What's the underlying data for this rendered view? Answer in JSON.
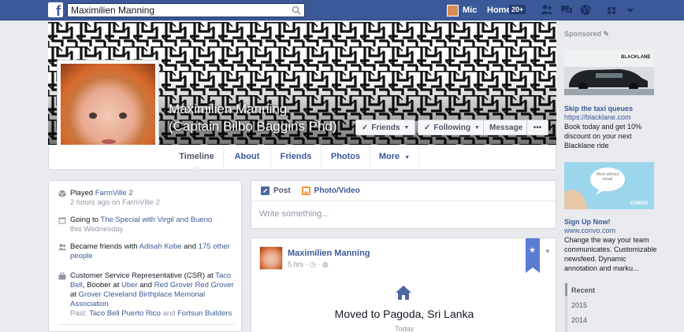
{
  "topbar": {
    "logo": "f",
    "search_value": "Maximilien Manning",
    "user_name": "Mic",
    "home_label": "Home",
    "home_count": "20+"
  },
  "profile": {
    "name": "Maximilien Manning",
    "nickname": "(Captain Bilbo Baggins Phd)"
  },
  "cover_buttons": {
    "friends": "Friends",
    "following": "Following",
    "message": "Message",
    "more": "•••"
  },
  "tabs": [
    {
      "label": "Timeline"
    },
    {
      "label": "About"
    },
    {
      "label": "Friends"
    },
    {
      "label": "Photos"
    },
    {
      "label": "More"
    }
  ],
  "activity": {
    "a1": {
      "pre": "Played ",
      "link": "FarmVille 2",
      "sub": "2 hours ago on FarmVille 2"
    },
    "a2": {
      "pre": "Going to ",
      "link": "The Special with Virgil and Bueno",
      "sub": "this Wednesday"
    },
    "a3": {
      "pre": "Became friends with ",
      "link1": "Adisah Kobe",
      "mid": " and ",
      "link2": "175 other people"
    },
    "a4": {
      "pre": "Customer Service Representative (CSR) at ",
      "l1": "Taco Bell",
      "t1": ", ",
      "l2": "Boober",
      "t2": " at ",
      "l3": "Uber",
      "t3": " and ",
      "l4": "Red Grover Red Grover",
      "t4": " at ",
      "l5": "Grover Cleveland Birthplace Memorial Association",
      "past_pre": "Past: ",
      "p1": "Taco Bell Puerto Rico",
      "p_and": " and ",
      "p2": "Fortsun Builders"
    }
  },
  "composer": {
    "tab_post": "Post",
    "tab_photo": "Photo/Video",
    "placeholder": "Write something..."
  },
  "story": {
    "author": "Maximilien Manning",
    "time": "5 hrs",
    "event": "Moved to Pagoda, Sri Lanka",
    "when": "Today"
  },
  "right": {
    "sponsored": "Sponsored",
    "ad1": {
      "brand": "BLACKLANE",
      "title": "Skip the taxi queues",
      "url": "https://blacklane.com",
      "body": "Book today and get 10% discount on your next Blacklane ride"
    },
    "ad2": {
      "bubble": "Work without email",
      "brand": "CONVO",
      "title": "Sign Up Now!",
      "url": "www.convo.com",
      "body": "Change the way your team communicates. Customizable newsfeed. Dynamic annotation and marku..."
    },
    "timeline_years": [
      "Recent",
      "2015",
      "2014"
    ]
  },
  "colors": {
    "brand_blue": "#3b5998",
    "page_bg": "#e9eaed",
    "link": "#3b5998",
    "muted": "#9197a3"
  }
}
